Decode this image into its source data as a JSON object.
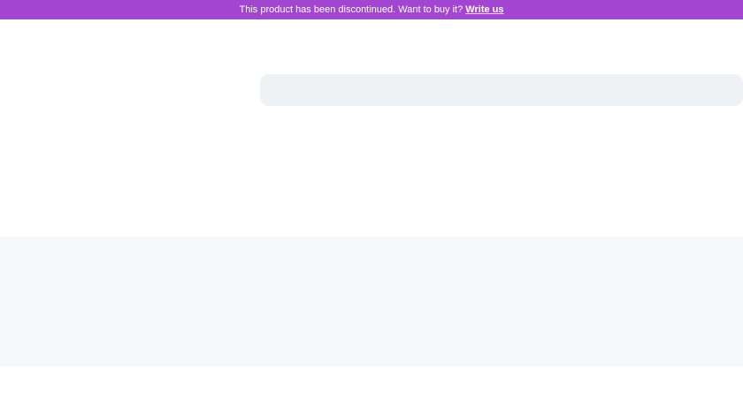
{
  "banner": {
    "message": "This product has been discontinued. Want to buy it?",
    "link_label": "Write us",
    "color": "#a245d0"
  },
  "search": {
    "placeholder": ""
  }
}
